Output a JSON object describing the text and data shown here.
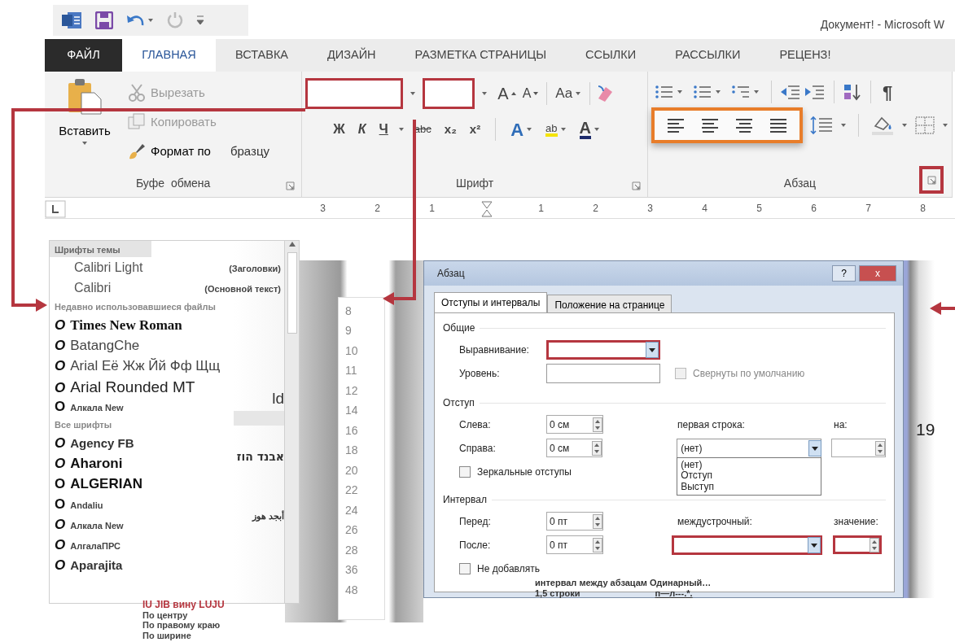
{
  "window": {
    "title": "Документ! - Microsoft W"
  },
  "ribbon_tabs": [
    {
      "label": "ФАЙЛ",
      "kind": "file",
      "selected": false
    },
    {
      "label": "ГЛАВНАЯ",
      "kind": "tab",
      "selected": true
    },
    {
      "label": "ВСТАВКА",
      "kind": "tab",
      "selected": false
    },
    {
      "label": "ДИЗАЙН",
      "kind": "tab",
      "selected": false
    },
    {
      "label": "РАЗМЕТКА СТРАНИЦЫ",
      "kind": "tab",
      "selected": false
    },
    {
      "label": "ССЫЛКИ",
      "kind": "tab",
      "selected": false
    },
    {
      "label": "РАССЫЛКИ",
      "kind": "tab",
      "selected": false
    },
    {
      "label": "РЕЦЕНЗ!",
      "kind": "tab",
      "selected": false
    }
  ],
  "clipboard": {
    "paste": "Вставить",
    "cut": "Вырезать",
    "copy": "Копировать",
    "format_painter": "Формат по",
    "format_painter_tail": "бразцу",
    "group_label": "Буфе",
    "group_label_tail": "обмена"
  },
  "font_group": {
    "size_buttons": [
      "A",
      "A"
    ],
    "case_button": "Aa",
    "format_buttons": [
      "Ж",
      "К",
      "Ч",
      "abc",
      "x₂",
      "x²"
    ],
    "effects": [
      "A",
      "ab",
      "A"
    ],
    "label": "Шрифт"
  },
  "paragraph_group": {
    "pilcrow": "¶",
    "label": "Абзац"
  },
  "ruler": {
    "left_labels": [
      "3",
      "2",
      "1"
    ],
    "right_labels": [
      "1",
      "2",
      "3",
      "4",
      "5",
      "6",
      "7",
      "8"
    ]
  },
  "font_dropdown": {
    "theme_header": "Шрифты темы",
    "theme_fonts": [
      {
        "name": "Calibri Light",
        "role": "(Заголовки)"
      },
      {
        "name": "Calibri",
        "role": "(Основной текст)"
      }
    ],
    "recent_header": "Недавно использовавшиеся файлы",
    "recent_fonts": [
      {
        "bullet": "O",
        "bullet_italic": true,
        "name": "Times New Roman",
        "kind": "serif"
      },
      {
        "bullet": "O",
        "bullet_italic": true,
        "name": "BatangChe",
        "kind": "plain"
      },
      {
        "bullet": "O",
        "bullet_italic": true,
        "name": "Arial Её Жж Йй Фф Щщ",
        "kind": "plain"
      },
      {
        "bullet": "O",
        "bullet_italic": true,
        "name": "Arial Rounded MT",
        "kind": "large"
      },
      {
        "bullet": "O",
        "bullet_italic": false,
        "name": "Алкала New",
        "kind": "small"
      }
    ],
    "all_header": "Все шрифты",
    "all_fonts": [
      {
        "bullet": "O",
        "bullet_italic": true,
        "name": "Agency FB",
        "kind": "bold"
      },
      {
        "bullet": "O",
        "bullet_italic": true,
        "name": "Aharoni",
        "kind": "heavy"
      },
      {
        "bullet": "O",
        "bullet_italic": false,
        "name": "ALGERIAN",
        "kind": "heavy"
      },
      {
        "bullet": "O",
        "bullet_italic": false,
        "name": "Andaliu",
        "kind": "small"
      },
      {
        "bullet": "O",
        "bullet_italic": true,
        "name": "Алкала New",
        "kind": "small"
      },
      {
        "bullet": "O",
        "bullet_italic": true,
        "name": "АлгалаПРС",
        "kind": "small"
      },
      {
        "bullet": "O",
        "bullet_italic": true,
        "name": "Aparajita",
        "kind": "bold"
      }
    ],
    "samples": [
      {
        "text": "ld",
        "kind": "large"
      },
      {
        "text": "אבנד הוז",
        "kind": "script"
      },
      {
        "text": "أبجد هوز",
        "kind": "small"
      }
    ]
  },
  "size_list": [
    "8",
    "9",
    "10",
    "11",
    "12",
    "14",
    "16",
    "18",
    "20",
    "22",
    "24",
    "26",
    "28",
    "36",
    "48"
  ],
  "dialog": {
    "title": "Абзац",
    "help": "?",
    "close": "x",
    "tabs": [
      {
        "label": "Отступы и интервалы",
        "selected": true
      },
      {
        "label": "Положение на странице",
        "selected": false
      }
    ],
    "general": {
      "heading": "Общие",
      "alignment_label": "Выравнивание:",
      "level_label": "Уровень:",
      "collapsed": {
        "label": "Свернуты по умолчанию",
        "checked": false,
        "disabled": true
      }
    },
    "indent": {
      "heading": "Отступ",
      "left_label": "Слева:",
      "left_value": "0 см",
      "right_label": "Справа:",
      "right_value": "0 см",
      "first_line_label": "первая строка:",
      "first_line_value": "(нет)",
      "first_line_options": [
        "(нет)",
        "Отступ",
        "Выступ"
      ],
      "by_label": "на:",
      "mirror": {
        "label": "Зеркальные отступы",
        "checked": false
      }
    },
    "spacing": {
      "heading": "Интервал",
      "before_label": "Перед:",
      "before_value": "0 пт",
      "after_label": "После:",
      "after_value": "0 пт",
      "line_label": "междустрочный:",
      "value_label": "значение:",
      "no_add": {
        "label": "Не добавлять",
        "checked": false
      }
    },
    "overlay_lines": [
      "интервал между абзацам Одинарный…",
      "1,5 строки",
      "п—л---.*."
    ]
  },
  "page_number": "19",
  "alignment_labels": [
    {
      "text": "IU JIB вину LUJU",
      "kind": "highlight"
    },
    {
      "text": "По центру",
      "kind": "plain"
    },
    {
      "text": "По правому краю",
      "kind": "plain"
    },
    {
      "text": "По ширине",
      "kind": "plain"
    }
  ]
}
